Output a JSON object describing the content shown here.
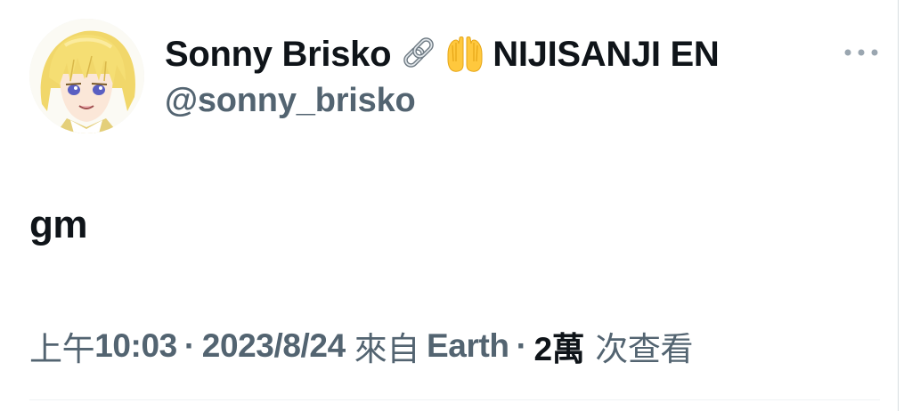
{
  "author": {
    "display_name": "Sonny Brisko",
    "affiliation": "NIJISANJI EN",
    "name_icons": [
      "link-icon",
      "raising-hands-emoji"
    ],
    "handle": "@sonny_brisko",
    "avatar_icon": "anime-avatar"
  },
  "tweet": {
    "text": "gm"
  },
  "meta": {
    "time_prefix": "上午",
    "time": "10:03",
    "separator": "·",
    "date": "2023/8/24",
    "source_prefix": "來自",
    "source": "Earth",
    "views_count": "2萬",
    "views_label": "次查看"
  },
  "actions": {
    "more_icon": "more-horizontal-icon"
  },
  "colors": {
    "primary_text": "#0f1419",
    "secondary_text": "#536471",
    "divider": "#eff3f4"
  }
}
